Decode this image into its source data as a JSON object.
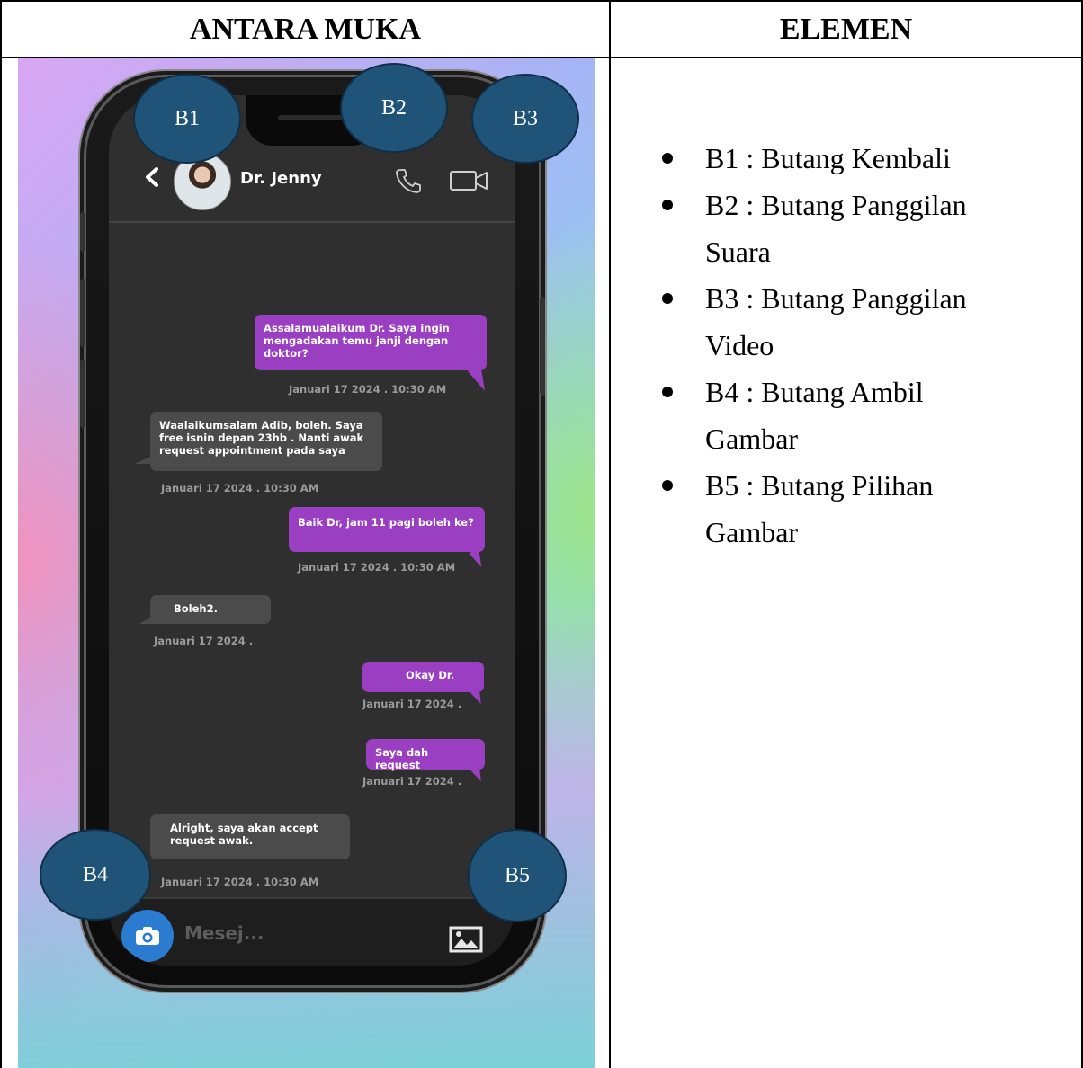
{
  "table": {
    "col1_header": "ANTARA MUKA",
    "col2_header": "ELEMEN"
  },
  "phone": {
    "contact_name": "Dr. Jenny",
    "input_placeholder": "Mesej...",
    "icons": {
      "back": "chevron-left-icon",
      "call": "phone-icon",
      "video": "video-camera-icon",
      "camera": "camera-icon",
      "gallery": "image-icon"
    },
    "colors": {
      "outgoing_bubble": "#9b3fc2",
      "incoming_bubble": "#4b4b4b",
      "camera_button": "#2b7bd0",
      "callout": "#1f5478"
    },
    "messages": [
      {
        "direction": "out",
        "lines": [
          "Assalamualaikum Dr. Saya ingin",
          "mengadakan temu janji dengan",
          "doktor?"
        ],
        "time": "Januari 17 2024 . 10:30 AM"
      },
      {
        "direction": "in",
        "lines": [
          "Waalaikumsalam Adib, boleh. Saya",
          "free isnin depan 23hb . Nanti awak",
          "request appointment pada saya"
        ],
        "time": "Januari 17 2024 . 10:30 AM"
      },
      {
        "direction": "out",
        "lines": [
          "Baik Dr, jam 11 pagi boleh ke?"
        ],
        "time": "Januari 17 2024 . 10:30 AM"
      },
      {
        "direction": "in",
        "lines": [
          "Boleh2."
        ],
        "time": "Januari 17 2024 ."
      },
      {
        "direction": "out",
        "lines": [
          "Okay Dr."
        ],
        "time": "Januari 17 2024 ."
      },
      {
        "direction": "out",
        "lines": [
          "Saya dah request"
        ],
        "time": "Januari 17 2024 ."
      },
      {
        "direction": "in",
        "lines": [
          "Alright, saya akan accept",
          "request awak."
        ],
        "time": "Januari 17 2024 . 10:30 AM"
      }
    ]
  },
  "callouts": [
    "B1",
    "B2",
    "B3",
    "B4",
    "B5"
  ],
  "elements": [
    "B1 : Butang Kembali",
    "B2 : Butang Panggilan Suara",
    "B3 : Butang Panggilan Video",
    "B4 : Butang Ambil Gambar",
    "B5 : Butang Pilihan Gambar"
  ]
}
